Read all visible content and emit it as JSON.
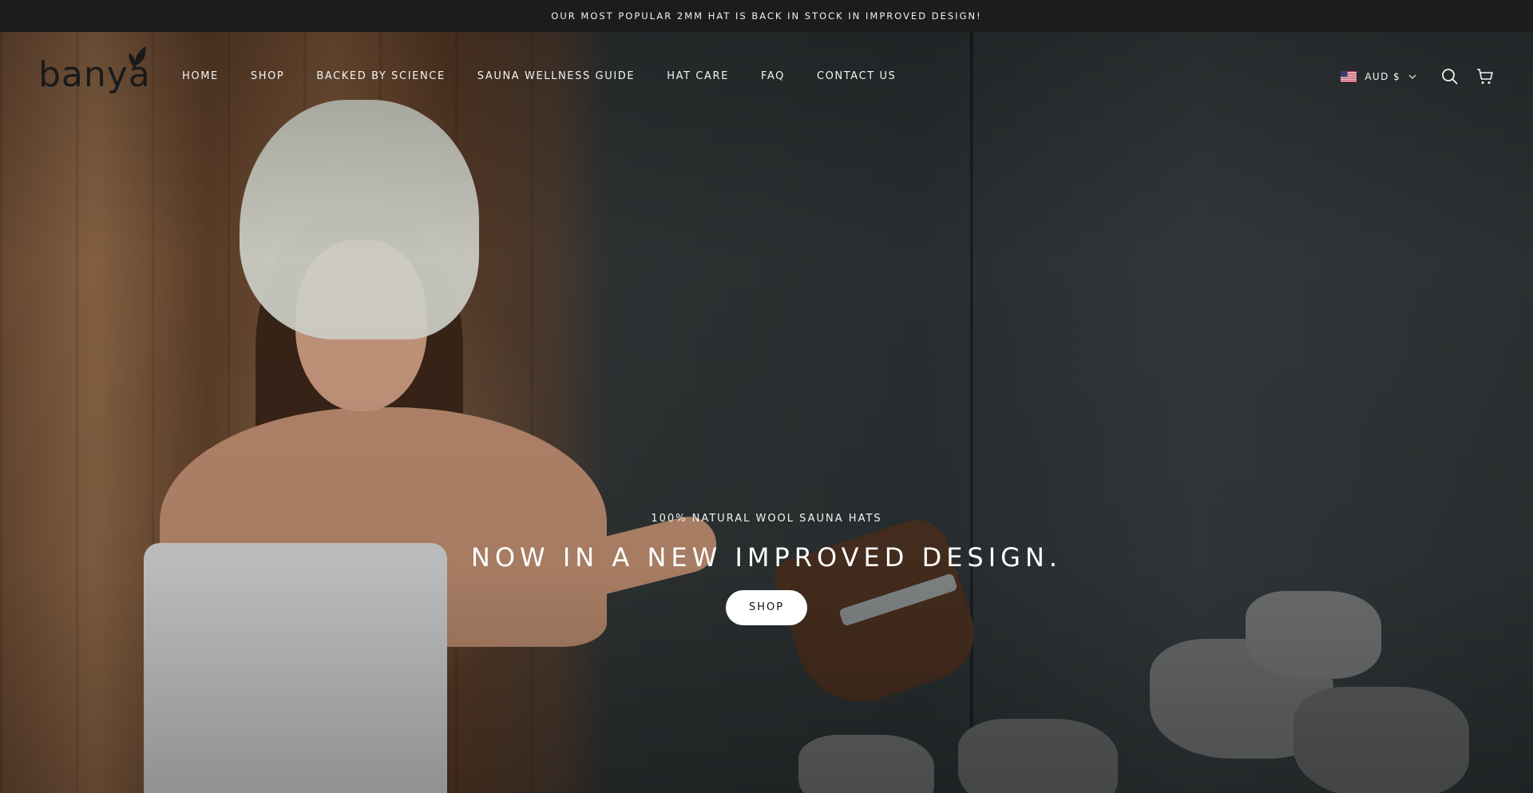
{
  "announcement": {
    "text": "OUR MOST POPULAR 2MM HAT IS BACK IN STOCK IN IMPROVED DESIGN!"
  },
  "header": {
    "logo_text": "banya",
    "nav": [
      {
        "label": "HOME"
      },
      {
        "label": "SHOP"
      },
      {
        "label": "BACKED BY SCIENCE"
      },
      {
        "label": "SAUNA WELLNESS GUIDE"
      },
      {
        "label": "HAT CARE"
      },
      {
        "label": "FAQ"
      },
      {
        "label": "CONTACT US"
      }
    ],
    "currency": {
      "label": "AUD $",
      "flag_icon": "us-flag-icon"
    },
    "icons": {
      "search": "search-icon",
      "cart": "cart-icon",
      "chevron": "chevron-down-icon"
    }
  },
  "hero": {
    "eyebrow": "100% NATURAL WOOL SAUNA HATS",
    "headline": "NOW IN A NEW IMPROVED DESIGN.",
    "cta_label": "SHOP"
  },
  "colors": {
    "announcement_bg": "#1b1c1e",
    "nav_text": "#f3f3f3",
    "button_bg": "#ffffff",
    "button_text": "#111111",
    "logo_color": "#1a1a1a"
  }
}
